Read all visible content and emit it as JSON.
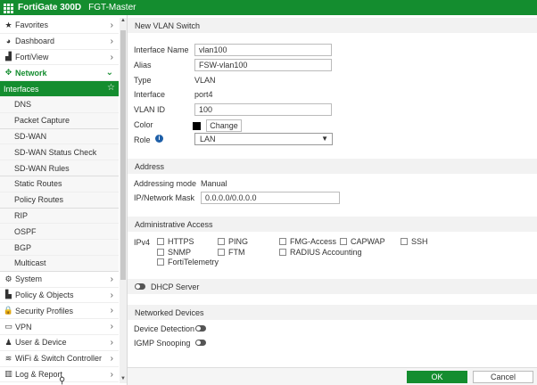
{
  "header": {
    "product": "FortiGate 300D",
    "hostname": "FGT-Master"
  },
  "nav": [
    {
      "label": "Favorites",
      "icon": "star-icon",
      "glyph": "★",
      "chev": "›",
      "kind": "top"
    },
    {
      "label": "Dashboard",
      "icon": "dashboard-icon",
      "glyph": "◕",
      "chev": "›",
      "kind": "top"
    },
    {
      "label": "FortiView",
      "icon": "chart-icon",
      "glyph": "▟",
      "chev": "›",
      "kind": "top"
    },
    {
      "label": "Network",
      "icon": "network-icon",
      "glyph": "✥",
      "chev": "⌄",
      "kind": "header-active"
    },
    {
      "label": "Interfaces",
      "kind": "active"
    },
    {
      "label": "DNS",
      "kind": "sub"
    },
    {
      "label": "Packet Capture",
      "kind": "sub gap"
    },
    {
      "label": "SD-WAN",
      "kind": "sub"
    },
    {
      "label": "SD-WAN Status Check",
      "kind": "sub"
    },
    {
      "label": "SD-WAN Rules",
      "kind": "sub gap"
    },
    {
      "label": "Static Routes",
      "kind": "sub"
    },
    {
      "label": "Policy Routes",
      "kind": "sub gap"
    },
    {
      "label": "RIP",
      "kind": "sub"
    },
    {
      "label": "OSPF",
      "kind": "sub"
    },
    {
      "label": "BGP",
      "kind": "sub"
    },
    {
      "label": "Multicast",
      "kind": "sub gap"
    },
    {
      "label": "System",
      "icon": "gear-icon",
      "glyph": "⚙",
      "chev": "›",
      "kind": "top"
    },
    {
      "label": "Policy & Objects",
      "icon": "policy-icon",
      "glyph": "▙",
      "chev": "›",
      "kind": "top"
    },
    {
      "label": "Security Profiles",
      "icon": "lock-icon",
      "glyph": "🔒",
      "chev": "›",
      "kind": "top"
    },
    {
      "label": "VPN",
      "icon": "monitor-icon",
      "glyph": "▭",
      "chev": "›",
      "kind": "top"
    },
    {
      "label": "User & Device",
      "icon": "user-icon",
      "glyph": "♟",
      "chev": "›",
      "kind": "top"
    },
    {
      "label": "WiFi & Switch Controller",
      "icon": "wifi-icon",
      "glyph": "≋",
      "chev": "›",
      "kind": "top"
    },
    {
      "label": "Log & Report",
      "icon": "chart-icon",
      "glyph": "▥",
      "chev": "›",
      "kind": "top"
    }
  ],
  "form": {
    "title": "New VLAN Switch",
    "interface_name_label": "Interface Name",
    "interface_name_value": "vlan100",
    "alias_label": "Alias",
    "alias_value": "FSW-vlan100",
    "type_label": "Type",
    "type_value": "VLAN",
    "interface_label": "Interface",
    "interface_value": "port4",
    "vlan_id_label": "VLAN ID",
    "vlan_id_value": "100",
    "color_label": "Color",
    "color_value": "#000000",
    "change_button": "Change",
    "role_label": "Role",
    "role_value": "LAN"
  },
  "address": {
    "title": "Address",
    "mode_label": "Addressing mode",
    "mode_value": "Manual",
    "mask_label": "IP/Network Mask",
    "mask_value": "0.0.0.0/0.0.0.0"
  },
  "admin": {
    "title": "Administrative Access",
    "ipv4_label": "IPv4",
    "https": "HTTPS",
    "ping": "PING",
    "fmg": "FMG-Access",
    "capwap": "CAPWAP",
    "ssh": "SSH",
    "snmp": "SNMP",
    "ftm": "FTM",
    "radius": "RADIUS Accounting",
    "fortitelemetry": "FortiTelemetry"
  },
  "dhcp": {
    "label": "DHCP Server"
  },
  "devices": {
    "title": "Networked Devices",
    "detection_label": "Device Detection",
    "igmp_label": "IGMP Snooping"
  },
  "footer": {
    "ok": "OK",
    "cancel": "Cancel"
  },
  "colors": {
    "brand_green": "#148d2f"
  }
}
